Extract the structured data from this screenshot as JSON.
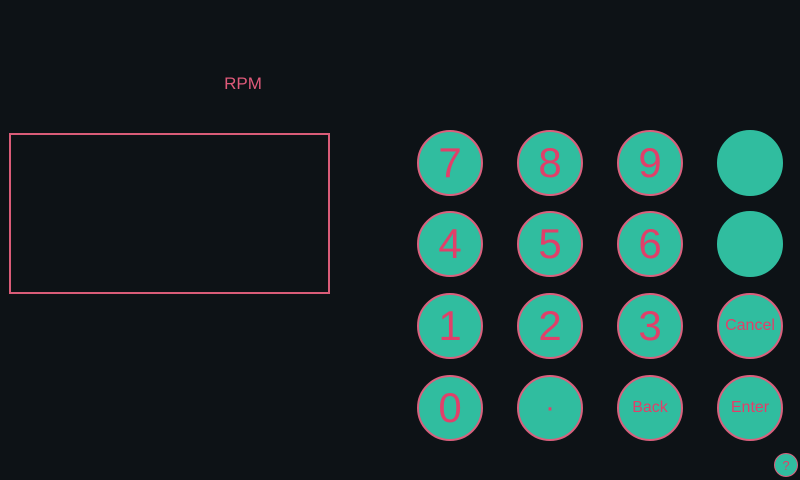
{
  "field": {
    "label": "RPM",
    "value": ""
  },
  "keypad": {
    "k7": "7",
    "k8": "8",
    "k9": "9",
    "kblank1": "",
    "k4": "4",
    "k5": "5",
    "k6": "6",
    "kblank2": "",
    "k1": "1",
    "k2": "2",
    "k3": "3",
    "cancel": "Cancel",
    "k0": "0",
    "dot": "·",
    "back": "Back",
    "enter": "Enter"
  },
  "help": {
    "label": "?"
  },
  "colors": {
    "background": "#0d1216",
    "key_fill": "#30bd9f",
    "accent": "#e0406a",
    "border": "#d95c78"
  }
}
